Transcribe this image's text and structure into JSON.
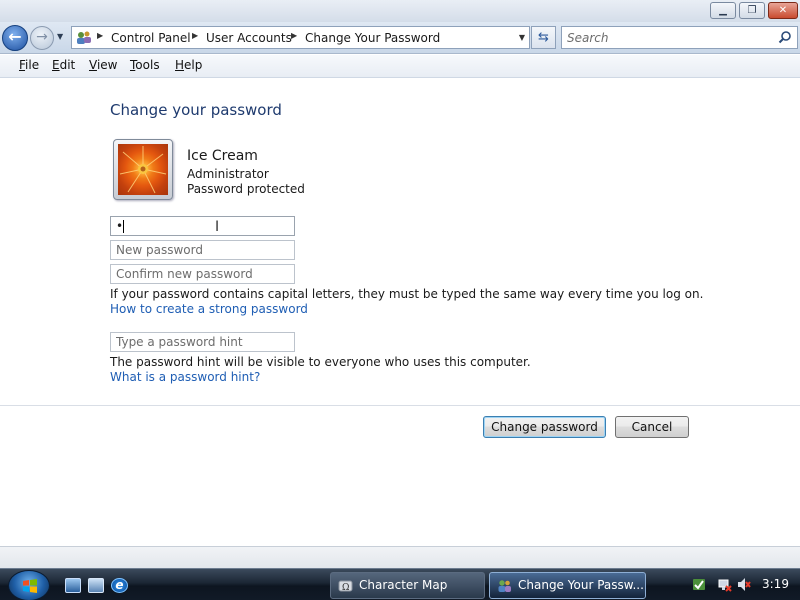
{
  "window": {
    "minimize_glyph": "▁",
    "maximize_glyph": "❐",
    "close_glyph": "✕"
  },
  "navigation": {
    "back_glyph": "←",
    "forward_glyph": "→",
    "address": {
      "breadcrumbs": [
        "Control Panel",
        "User Accounts",
        "Change Your Password"
      ],
      "separator_glyph": "▶",
      "dropdown_glyph": "▼"
    },
    "refresh_glyph": "⇆",
    "search": {
      "placeholder": "Search",
      "icon": "search-icon"
    }
  },
  "menu": {
    "items": [
      {
        "label": "File",
        "mnemonic": "F"
      },
      {
        "label": "Edit",
        "mnemonic": "E"
      },
      {
        "label": "View",
        "mnemonic": "V"
      },
      {
        "label": "Tools",
        "mnemonic": "T"
      },
      {
        "label": "Help",
        "mnemonic": "H"
      }
    ]
  },
  "page": {
    "title": "Change your password",
    "user": {
      "name": "Ice Cream",
      "role": "Administrator",
      "status": "Password protected"
    },
    "current_password": {
      "value": "•"
    },
    "new_password": {
      "placeholder": "New password"
    },
    "confirm_password": {
      "placeholder": "Confirm new password"
    },
    "caps_note": "If your password contains capital letters, they must be typed the same way every time you log on.",
    "strong_password_link": "How to create a strong password",
    "hint": {
      "placeholder": "Type a password hint"
    },
    "hint_note": "The password hint will be visible to everyone who uses this computer.",
    "hint_link": "What is a password hint?",
    "buttons": {
      "change": "Change password",
      "cancel": "Cancel"
    }
  },
  "taskbar": {
    "tasks": [
      {
        "label": "Character Map",
        "active": false
      },
      {
        "label": "Change Your Passw...",
        "active": true
      }
    ],
    "ie_glyph": "e",
    "clock": "3:19"
  },
  "colors": {
    "title_blue": "#1e3a6e",
    "link_blue": "#1f5eb4",
    "taskbar_dark": "#111a27"
  }
}
